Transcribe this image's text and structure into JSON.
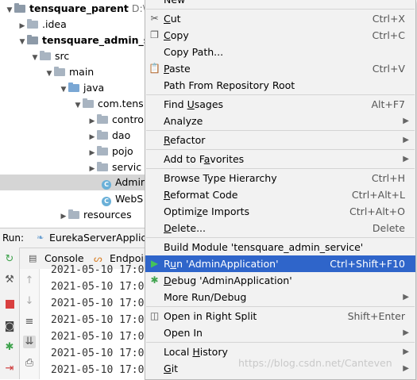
{
  "tree": {
    "items": [
      {
        "label": "tensquare_parent",
        "path": "D:\\ma",
        "depth": 0,
        "icon": "module-folder-icon",
        "expanded": true,
        "bold": true
      },
      {
        "label": ".idea",
        "depth": 1,
        "icon": "folder-icon",
        "expanded": false
      },
      {
        "label": "tensquare_admin_ser",
        "depth": 1,
        "icon": "module-folder-icon",
        "expanded": true,
        "bold": true
      },
      {
        "label": "src",
        "depth": 2,
        "icon": "folder-icon",
        "expanded": true
      },
      {
        "label": "main",
        "depth": 3,
        "icon": "folder-icon",
        "expanded": true
      },
      {
        "label": "java",
        "depth": 4,
        "icon": "source-folder-icon",
        "expanded": true
      },
      {
        "label": "com.tens",
        "depth": 5,
        "icon": "package-icon",
        "expanded": true
      },
      {
        "label": "contro",
        "depth": 6,
        "icon": "package-icon",
        "expanded": false
      },
      {
        "label": "dao",
        "depth": 6,
        "icon": "package-icon",
        "expanded": false
      },
      {
        "label": "pojo",
        "depth": 6,
        "icon": "package-icon",
        "expanded": false
      },
      {
        "label": "servic",
        "depth": 6,
        "icon": "package-icon",
        "expanded": false
      },
      {
        "label": "Admin",
        "depth": 6,
        "icon": "class-icon",
        "selected": true
      },
      {
        "label": "WebS",
        "depth": 6,
        "icon": "class-icon"
      },
      {
        "label": "resources",
        "depth": 4,
        "icon": "resources-folder-icon",
        "expanded": false
      }
    ]
  },
  "run": {
    "label": "Run:",
    "config": "EurekaServerApplica",
    "tabs": [
      "Console",
      "Endpoin"
    ]
  },
  "log": {
    "lines": [
      "2021-05-10 17:0",
      "2021-05-10 17:0",
      "2021-05-10 17:0",
      "2021-05-10 17:0",
      "2021-05-10 17:0",
      "2021-05-10 17:0",
      "2021-05-10 17:0"
    ]
  },
  "menu": {
    "new": "New",
    "cut": {
      "label": "Cut",
      "shortcut": "Ctrl+X"
    },
    "copy": {
      "label": "Copy",
      "shortcut": "Ctrl+C"
    },
    "copy_path": {
      "label": "Copy Path..."
    },
    "paste": {
      "label": "Paste",
      "shortcut": "Ctrl+V"
    },
    "path_from_root": {
      "label": "Path From Repository Root"
    },
    "find_usages": {
      "label": "Find Usages",
      "shortcut": "Alt+F7"
    },
    "analyze": {
      "label": "Analyze"
    },
    "refactor": {
      "label": "Refactor"
    },
    "add_favorites": {
      "label": "Add to Favorites"
    },
    "browse_hierarchy": {
      "label": "Browse Type Hierarchy",
      "shortcut": "Ctrl+H"
    },
    "reformat": {
      "label": "Reformat Code",
      "shortcut": "Ctrl+Alt+L"
    },
    "optimize": {
      "label": "Optimize Imports",
      "shortcut": "Ctrl+Alt+O"
    },
    "delete": {
      "label": "Delete...",
      "shortcut": "Delete"
    },
    "build_module": {
      "label": "Build Module 'tensquare_admin_service'"
    },
    "run": {
      "label": "Run 'AdminApplication'",
      "shortcut": "Ctrl+Shift+F10"
    },
    "debug": {
      "label": "Debug 'AdminApplication'"
    },
    "more_run": {
      "label": "More Run/Debug"
    },
    "open_split": {
      "label": "Open in Right Split",
      "shortcut": "Shift+Enter"
    },
    "open_in": {
      "label": "Open In"
    },
    "local_history": {
      "label": "Local History"
    },
    "git": {
      "label": "Git"
    }
  },
  "colors": {
    "highlight": "#2f65ca",
    "menu_bg": "#f2f2f2",
    "run_icon": "#3fa34d"
  },
  "watermark": "https://blog.csdn.net/Canteven"
}
